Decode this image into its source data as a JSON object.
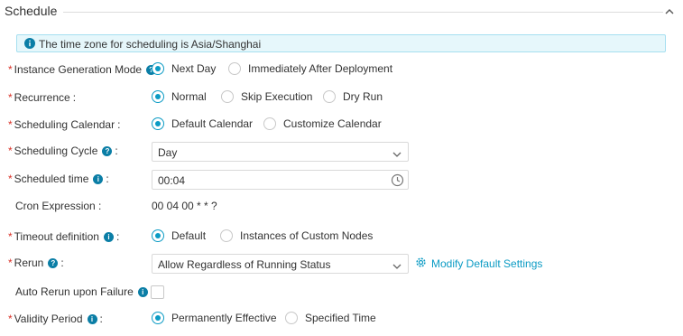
{
  "section": {
    "title": "Schedule"
  },
  "banner": {
    "text": "The time zone for scheduling is Asia/Shanghai"
  },
  "form": {
    "instance_mode": {
      "label": "Instance Generation Mode",
      "options": [
        "Next Day",
        "Immediately After Deployment"
      ]
    },
    "recurrence": {
      "label": "Recurrence",
      "options": [
        "Normal",
        "Skip Execution",
        "Dry Run"
      ]
    },
    "calendar": {
      "label": "Scheduling Calendar",
      "options": [
        "Default Calendar",
        "Customize Calendar"
      ]
    },
    "cycle": {
      "label": "Scheduling Cycle",
      "value": "Day"
    },
    "scheduled_time": {
      "label": "Scheduled time",
      "value": "00:04"
    },
    "cron": {
      "label": "Cron Expression :",
      "value": "00 04 00 * * ?"
    },
    "timeout": {
      "label": "Timeout definition",
      "options": [
        "Default",
        "Instances of Custom Nodes"
      ]
    },
    "rerun": {
      "label": "Rerun",
      "value": "Allow Regardless of Running Status",
      "link": "Modify Default Settings"
    },
    "auto_rerun": {
      "label": "Auto Rerun upon Failure"
    },
    "validity": {
      "label": "Validity Period",
      "options": [
        "Permanently Effective",
        "Specified Time"
      ]
    }
  },
  "colors": {
    "accent": "#0b9bc4",
    "required": "#d93026",
    "banner_bg": "#e6f7fb",
    "banner_border": "#a6dff0"
  },
  "icons": [
    "chevron-up-icon",
    "info-icon",
    "question-icon",
    "gear-icon",
    "clock-icon",
    "chevron-down-icon"
  ]
}
